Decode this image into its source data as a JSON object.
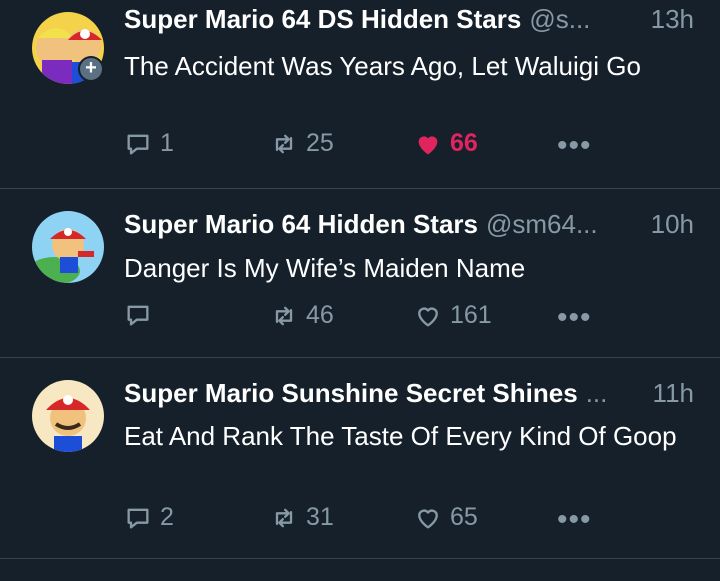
{
  "tweets": [
    {
      "name": "Super Mario 64 DS Hidden Stars",
      "handle": "@s...",
      "time": "13h",
      "text": "The Accident Was Years Ago, Let Waluigi Go",
      "replies": "1",
      "retweets": "25",
      "likes": "66",
      "liked": true,
      "has_follow_badge": true,
      "more": "•••"
    },
    {
      "name": "Super Mario 64 Hidden Stars",
      "handle": "@sm64...",
      "time": "10h",
      "text": "Danger Is My Wife’s Maiden Name",
      "replies": "",
      "retweets": "46",
      "likes": "161",
      "liked": false,
      "more": "•••"
    },
    {
      "name": "Super Mario Sunshine Secret Shines",
      "ellipsis": "...",
      "time": "11h",
      "text": "Eat And Rank The Taste Of Every Kind Of Goop",
      "replies": "2",
      "retweets": "31",
      "likes": "65",
      "liked": false,
      "more": "•••"
    }
  ],
  "follow_badge": "+",
  "colors": {
    "background": "#15202b",
    "divider": "#38444d",
    "secondary_text": "#8899a6",
    "like_active": "#e0245e"
  }
}
